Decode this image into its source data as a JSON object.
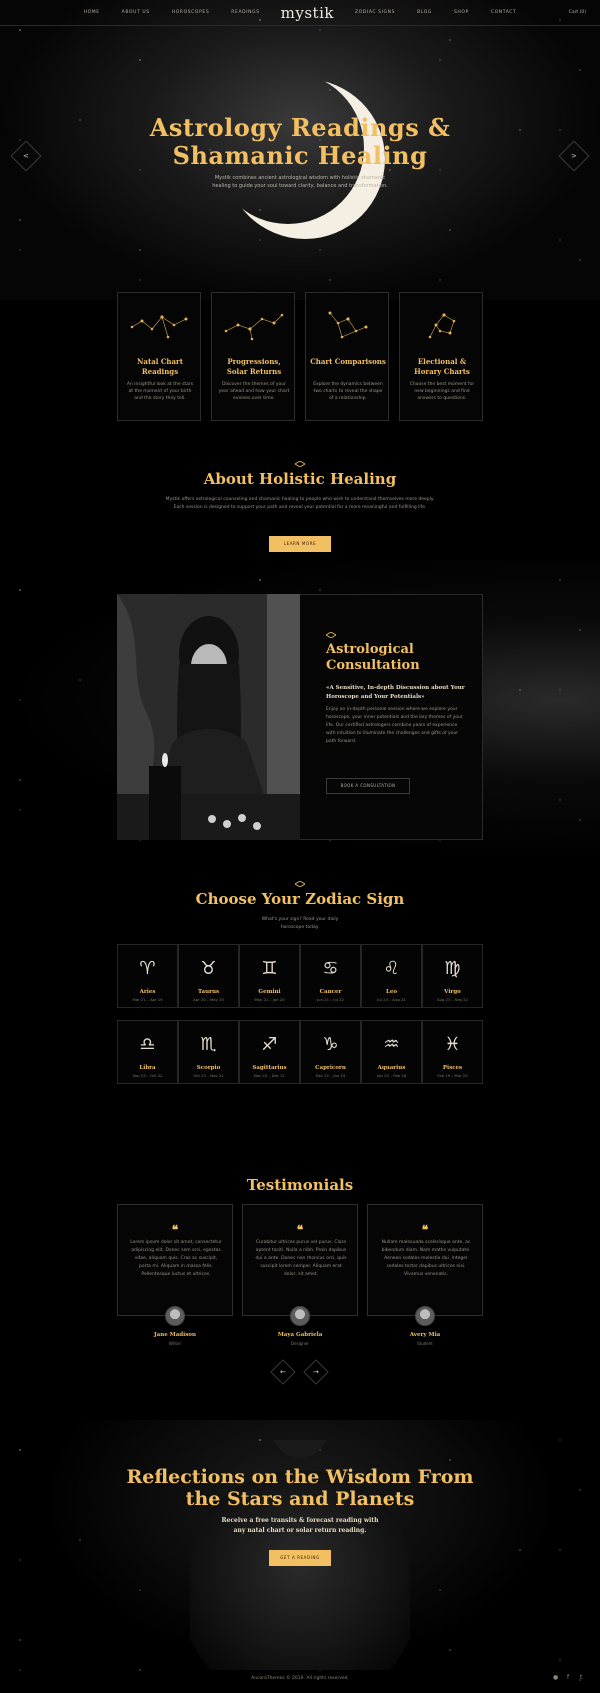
{
  "nav": {
    "left": [
      "Home",
      "About Us",
      "Horoscopes",
      "Readings"
    ],
    "logo": "mystik",
    "right": [
      "Zodiac Signs",
      "Blog",
      "Shop",
      "Contact"
    ],
    "cart": "Cart (0)"
  },
  "hero": {
    "title_line1": "Astrology Readings &",
    "title_line2": "Shamanic Healing",
    "subtitle": "Mystik combines ancient astrological wisdom with holistic shamanic healing to guide your soul toward clarity, balance and transformation.",
    "prev_arrow": "<",
    "next_arrow": ">"
  },
  "services": [
    {
      "title": "Natal Chart Readings",
      "desc": "An insightful look at the stars at the moment of your birth and the story they tell."
    },
    {
      "title": "Progressions, Solar Returns",
      "desc": "Discover the themes of your year ahead and how your chart evolves over time."
    },
    {
      "title": "Chart Comparisons",
      "desc": "Explore the dynamics between two charts to reveal the shape of a relationship."
    },
    {
      "title": "Electional & Horary Charts",
      "desc": "Choose the best moment for new beginnings and find answers to questions."
    }
  ],
  "about": {
    "title": "About Holistic Healing",
    "text": "Mystik offers astrological counseling and shamanic healing to people who wish to understand themselves more deeply. Each session is designed to support your path and reveal your potential for a more meaningful and fulfilling life.",
    "button": "Learn More"
  },
  "consultation": {
    "title": "Astrological Consultation",
    "subtitle": "«A Sensitive, In-depth Discussion about Your Horoscope and Your Potentials»",
    "text": "Enjoy an in-depth personal session where we explore your horoscope, your inner potentials and the key themes of your life. Our certified astrologers combine years of experience with intuition to illuminate the challenges and gifts of your path forward.",
    "button": "Book a Consultation"
  },
  "zodiac": {
    "title": "Choose Your Zodiac Sign",
    "subtitle": "What's your sign? Read your daily horoscope today.",
    "signs": [
      {
        "symbol": "♈",
        "name": "Aries",
        "dates": "Mar 21 – Apr 19"
      },
      {
        "symbol": "♉",
        "name": "Taurus",
        "dates": "Apr 20 – May 20"
      },
      {
        "symbol": "♊",
        "name": "Gemini",
        "dates": "May 21 – Jun 20"
      },
      {
        "symbol": "♋",
        "name": "Cancer",
        "dates": "Jun 21 – Jul 22"
      },
      {
        "symbol": "♌",
        "name": "Leo",
        "dates": "Jul 23 – Aug 22"
      },
      {
        "symbol": "♍",
        "name": "Virgo",
        "dates": "Aug 23 – Sep 22"
      },
      {
        "symbol": "♎",
        "name": "Libra",
        "dates": "Sep 23 – Oct 22"
      },
      {
        "symbol": "♏",
        "name": "Scorpio",
        "dates": "Oct 23 – Nov 21"
      },
      {
        "symbol": "♐",
        "name": "Sagittarius",
        "dates": "Nov 22 – Dec 21"
      },
      {
        "symbol": "♑",
        "name": "Capricorn",
        "dates": "Dec 22 – Jan 19"
      },
      {
        "symbol": "♒",
        "name": "Aquarius",
        "dates": "Jan 20 – Feb 18"
      },
      {
        "symbol": "♓",
        "name": "Pisces",
        "dates": "Feb 19 – Mar 20"
      }
    ]
  },
  "testimonials": {
    "title": "Testimonials",
    "items": [
      {
        "quote": "Lorem ipsum dolor sit amet, consectetur adipiscing elit. Donec sem orci, egestas vitae, aliquam quis. Cras ac suscipit, porta mi. Aliquam in massa felis. Pellentesque luctus et ultrices.",
        "name": "Jane Madison",
        "role": "Writer"
      },
      {
        "quote": "Curabitur ultrices purus vel purus. Class aptent taciti. Nulla a nibh. Proin dapibus dui a ante. Donec non rhoncus orci, quis suscipit lorem semper. Aliquam erat dolor, sit amet.",
        "name": "Maya Gabriela",
        "role": "Designer"
      },
      {
        "quote": "Nullam malesuada scelerisque ante, ac bibendum diam. Nam mattis vulputate. Aenean sodales molestie dui. Integer sodales tortor dapibus ultrices nisi. Vivamus venenatis.",
        "name": "Avery Mia",
        "role": "Student"
      }
    ],
    "prev": "←",
    "next": "→"
  },
  "reflections": {
    "title_line1": "Reflections on the Wisdom From",
    "title_line2": "the Stars and Planets",
    "subtitle": "Receive a free transits & forecast reading with any natal chart or solar return reading.",
    "button": "Get a Reading"
  },
  "footer": {
    "text": "AncoraThemes © 2019. All rights reserved.",
    "social": [
      "●",
      "f",
      "t"
    ]
  },
  "colors": {
    "accent": "#f2c063",
    "background": "#000000"
  }
}
